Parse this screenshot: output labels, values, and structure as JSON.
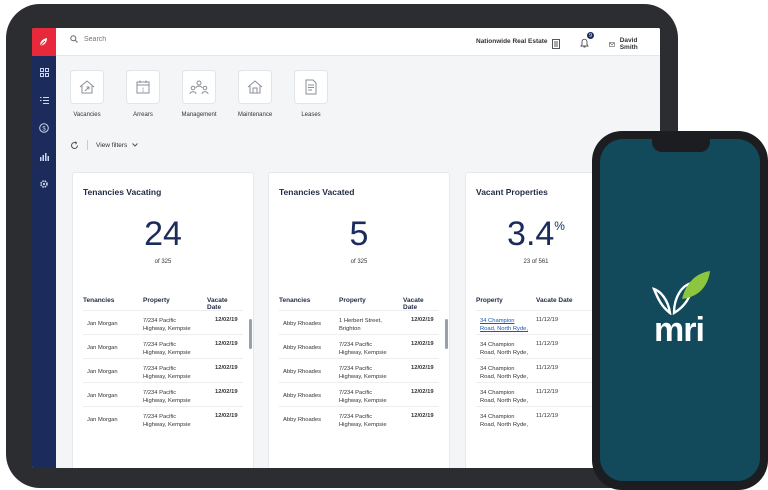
{
  "header": {
    "search_placeholder": "Search",
    "organization": "Nationwide Real Estate",
    "notification_count": "9",
    "user_name": "David Smith"
  },
  "tiles": [
    {
      "label": "Vacancies",
      "icon": "house-arrow-icon"
    },
    {
      "label": "Arrears",
      "icon": "calendar-icon"
    },
    {
      "label": "Management",
      "icon": "people-icon"
    },
    {
      "label": "Maintenance",
      "icon": "house-tool-icon"
    },
    {
      "label": "Leases",
      "icon": "document-icon"
    }
  ],
  "filters": {
    "label": "View filters"
  },
  "cards": {
    "vacating": {
      "title": "Tenancies Vacating",
      "value": "24",
      "sub": "of 325",
      "columns": [
        "Tenancies",
        "Property",
        "Vacate Date"
      ],
      "rows": [
        {
          "tenant": "Jan Morgan",
          "p1": "7/234 Pacific",
          "p2": "Highway, Kempsie",
          "date": "12/02/19"
        },
        {
          "tenant": "Jan Morgan",
          "p1": "7/234 Pacific",
          "p2": "Highway, Kempsie",
          "date": "12/02/19"
        },
        {
          "tenant": "Jan Morgan",
          "p1": "7/234 Pacific",
          "p2": "Highway, Kempsie",
          "date": "12/02/19"
        },
        {
          "tenant": "Jan Morgan",
          "p1": "7/234 Pacific",
          "p2": "Highway, Kempsie",
          "date": "12/02/19"
        },
        {
          "tenant": "Jan Morgan",
          "p1": "7/234 Pacific",
          "p2": "Highway, Kempsie",
          "date": "12/02/19"
        }
      ]
    },
    "vacated": {
      "title": "Tenancies Vacated",
      "value": "5",
      "sub": "of 325",
      "columns": [
        "Tenancies",
        "Property",
        "Vacate Date"
      ],
      "rows": [
        {
          "tenant": "Abby Rhoades",
          "p1": "1 Herbert Street,",
          "p2": "Brighton",
          "date": "12/02/19"
        },
        {
          "tenant": "Abby Rhoades",
          "p1": "7/234 Pacific",
          "p2": "Highway, Kempsie",
          "date": "12/02/19"
        },
        {
          "tenant": "Abby Rhoades",
          "p1": "7/234 Pacific",
          "p2": "Highway, Kempsie",
          "date": "12/02/19"
        },
        {
          "tenant": "Abby Rhoades",
          "p1": "7/234 Pacific",
          "p2": "Highway, Kempsie",
          "date": "12/02/19"
        },
        {
          "tenant": "Abby Rhoades",
          "p1": "7/234 Pacific",
          "p2": "Highway, Kempsie",
          "date": "12/02/19"
        }
      ]
    },
    "vacant": {
      "title": "Vacant Properties",
      "value": "3.4",
      "unit": "%",
      "sub": "23 of 561",
      "columns": [
        "Property",
        "Vacate Date"
      ],
      "rows": [
        {
          "p1": "34 Champion",
          "p2": "Road, North Ryde,",
          "date": "11/12/19"
        },
        {
          "p1": "34 Champion",
          "p2": "Road, North Ryde,",
          "date": "11/12/19"
        },
        {
          "p1": "34 Champion",
          "p2": "Road, North Ryde,",
          "date": "11/12/19"
        },
        {
          "p1": "34 Champion",
          "p2": "Road, North Ryde,",
          "date": "11/12/19"
        },
        {
          "p1": "34 Champion",
          "p2": "Road, North Ryde,",
          "date": "11/12/19"
        }
      ]
    }
  },
  "phone": {
    "brand": "mri",
    "background": "#124a5c"
  },
  "colors": {
    "sidebar": "#1a2b5c",
    "accent": "#e8283b",
    "leaf_green": "#8cc63f"
  }
}
